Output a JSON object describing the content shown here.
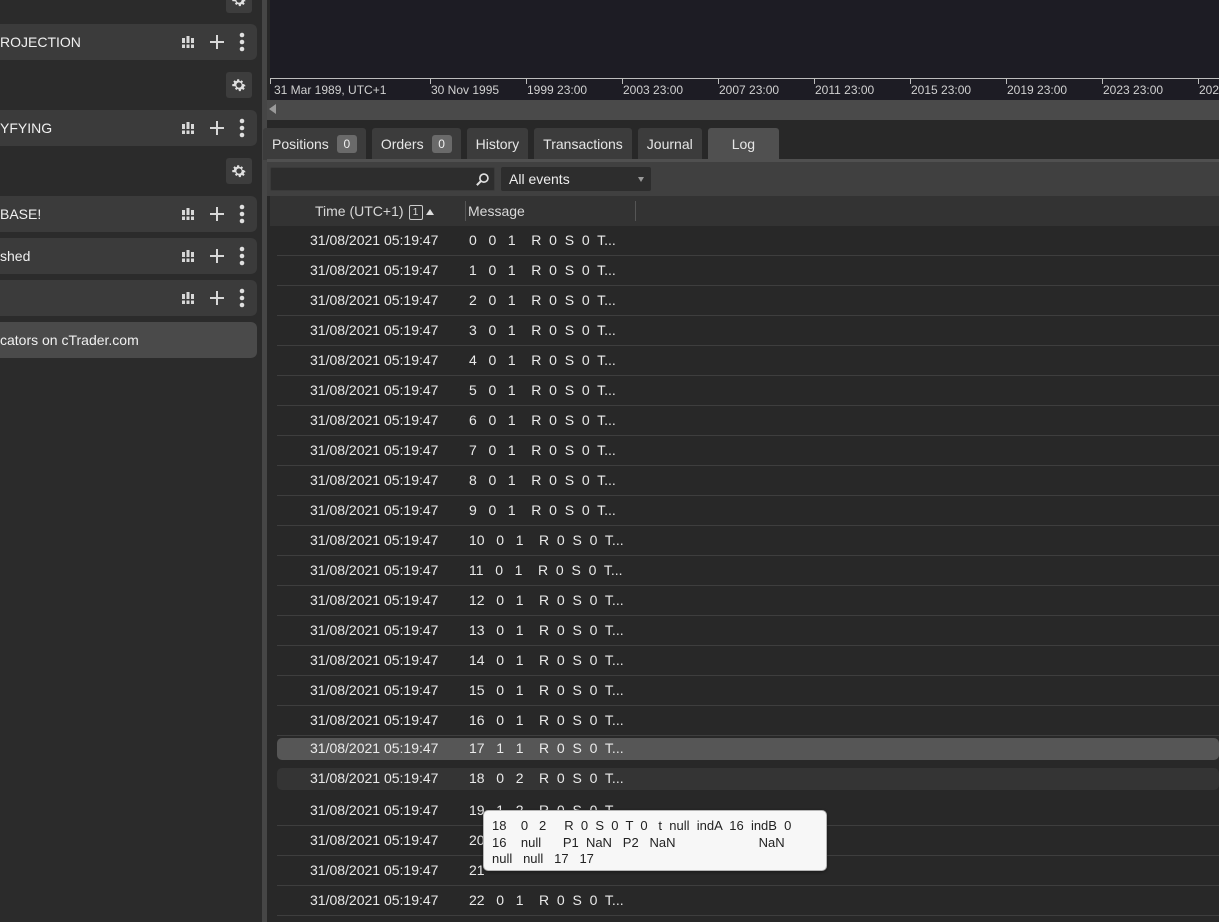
{
  "left_panel": {
    "rows": [
      {
        "label": "ROJECTION"
      },
      {
        "label": "YFYING"
      },
      {
        "label": "BASE!"
      },
      {
        "label": "shed"
      },
      {
        "label": ""
      }
    ],
    "link_label": "cators on cTrader.com"
  },
  "time_axis": {
    "ticks": [
      "31 Mar 1989, UTC+1",
      "30 Nov 1995",
      "1999 23:00",
      "2003 23:00",
      "2007 23:00",
      "2011 23:00",
      "2015 23:00",
      "2019 23:00",
      "2023 23:00",
      "202"
    ]
  },
  "tabs": [
    {
      "label": "Positions",
      "badge": "0"
    },
    {
      "label": "Orders",
      "badge": "0"
    },
    {
      "label": "History"
    },
    {
      "label": "Transactions"
    },
    {
      "label": "Journal"
    },
    {
      "label": "Log"
    }
  ],
  "active_tab": "Log",
  "filter": {
    "search_value": "",
    "events_selected": "All events"
  },
  "grid": {
    "columns": {
      "time": "Time (UTC+1)",
      "sort_index": "1",
      "message": "Message"
    },
    "rows": [
      {
        "time": "31/08/2021 05:19:47",
        "message": "0   0   1    R  0  S  0  T..."
      },
      {
        "time": "31/08/2021 05:19:47",
        "message": "1   0   1    R  0  S  0  T..."
      },
      {
        "time": "31/08/2021 05:19:47",
        "message": "2   0   1    R  0  S  0  T..."
      },
      {
        "time": "31/08/2021 05:19:47",
        "message": "3   0   1    R  0  S  0  T..."
      },
      {
        "time": "31/08/2021 05:19:47",
        "message": "4   0   1    R  0  S  0  T..."
      },
      {
        "time": "31/08/2021 05:19:47",
        "message": "5   0   1    R  0  S  0  T..."
      },
      {
        "time": "31/08/2021 05:19:47",
        "message": "6   0   1    R  0  S  0  T..."
      },
      {
        "time": "31/08/2021 05:19:47",
        "message": "7   0   1    R  0  S  0  T..."
      },
      {
        "time": "31/08/2021 05:19:47",
        "message": "8   0   1    R  0  S  0  T..."
      },
      {
        "time": "31/08/2021 05:19:47",
        "message": "9   0   1    R  0  S  0  T..."
      },
      {
        "time": "31/08/2021 05:19:47",
        "message": "10   0   1    R  0  S  0  T..."
      },
      {
        "time": "31/08/2021 05:19:47",
        "message": "11   0   1    R  0  S  0  T..."
      },
      {
        "time": "31/08/2021 05:19:47",
        "message": "12   0   1    R  0  S  0  T..."
      },
      {
        "time": "31/08/2021 05:19:47",
        "message": "13   0   1    R  0  S  0  T..."
      },
      {
        "time": "31/08/2021 05:19:47",
        "message": "14   0   1    R  0  S  0  T..."
      },
      {
        "time": "31/08/2021 05:19:47",
        "message": "15   0   1    R  0  S  0  T..."
      },
      {
        "time": "31/08/2021 05:19:47",
        "message": "16   0   1    R  0  S  0  T..."
      },
      {
        "time": "31/08/2021 05:19:47",
        "message": "17   1   1    R  0  S  0  T..."
      },
      {
        "time": "31/08/2021 05:19:47",
        "message": "18   0   2    R  0  S  0  T..."
      },
      {
        "time": "31/08/2021 05:19:47",
        "message": "19   1   2    R  0  S  0  T..."
      },
      {
        "time": "31/08/2021 05:19:47",
        "message": "20"
      },
      {
        "time": "31/08/2021 05:19:47",
        "message": "21"
      },
      {
        "time": "31/08/2021 05:19:47",
        "message": "22   0   1    R  0  S  0  T..."
      }
    ]
  },
  "tooltip": {
    "line1": "18    0   2     R  0  S  0  T  0   t  null  indA  16  indB  0",
    "line2": "16    null      P1  NaN   P2   NaN                       NaN",
    "line3": "null   null   17   17"
  },
  "colors": {
    "panel_bg": "#2a2a2a",
    "row_bg": "#3b3b3b",
    "selected_row": "#565656",
    "chart_bg": "#1d1c24",
    "tooltip_bg": "#f7f7f7"
  }
}
